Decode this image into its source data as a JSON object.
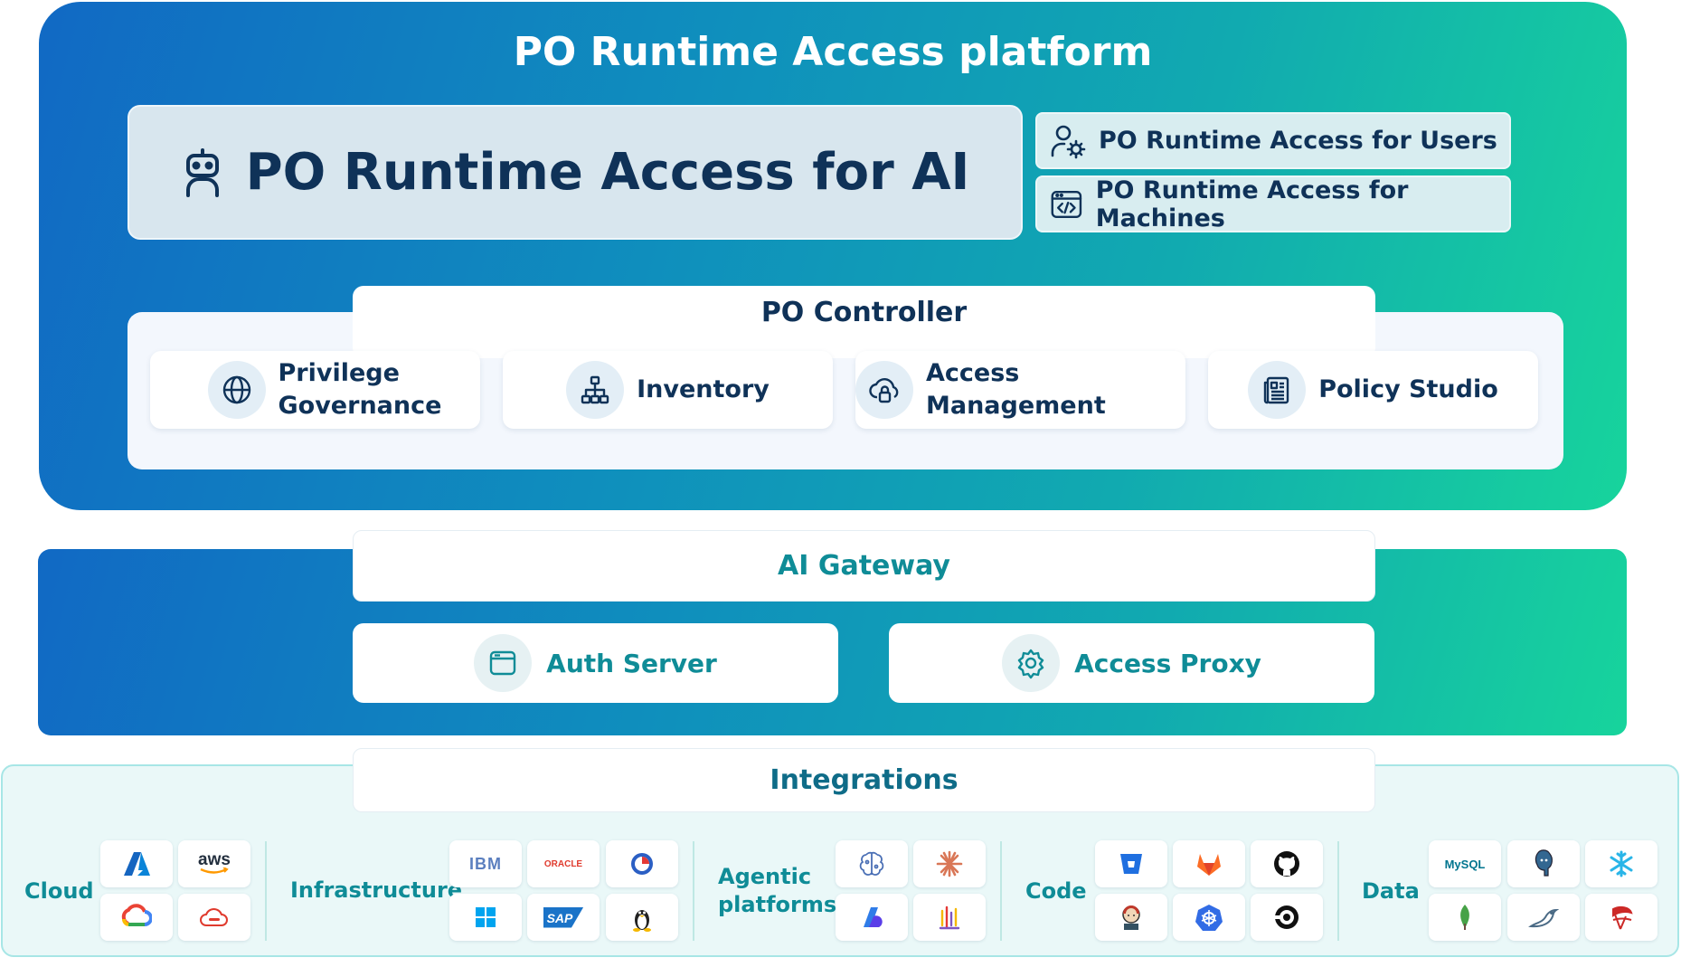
{
  "platform": {
    "title": "PO Runtime Access platform",
    "ai_label": "PO Runtime Access for AI",
    "users_label": "PO Runtime Access for Users",
    "machines_label": "PO Runtime Access for Machines"
  },
  "controller": {
    "title": "PO Controller",
    "cards": [
      {
        "label": "Privilege Governance",
        "icon": "globe-icon"
      },
      {
        "label": "Inventory",
        "icon": "hierarchy-icon"
      },
      {
        "label": "Access Management",
        "icon": "cloud-lock-icon"
      },
      {
        "label": "Policy Studio",
        "icon": "document-icon"
      }
    ]
  },
  "gateway": {
    "title": "AI Gateway",
    "auth_label": "Auth Server",
    "proxy_label": "Access Proxy"
  },
  "integrations": {
    "title": "Integrations",
    "categories": {
      "cloud": "Cloud",
      "infrastructure": "Infrastructure",
      "agentic": "Agentic platforms",
      "code": "Code",
      "data": "Data"
    },
    "logos": {
      "aws": "aws",
      "ibm": "IBM",
      "oracle": "ORACLE",
      "sap": "SAP",
      "mysql": "MySQL"
    }
  },
  "colors": {
    "navy": "#0f3258",
    "teal": "#0f8c97",
    "gradient_start": "#1169c4",
    "gradient_end": "#17d49c"
  }
}
